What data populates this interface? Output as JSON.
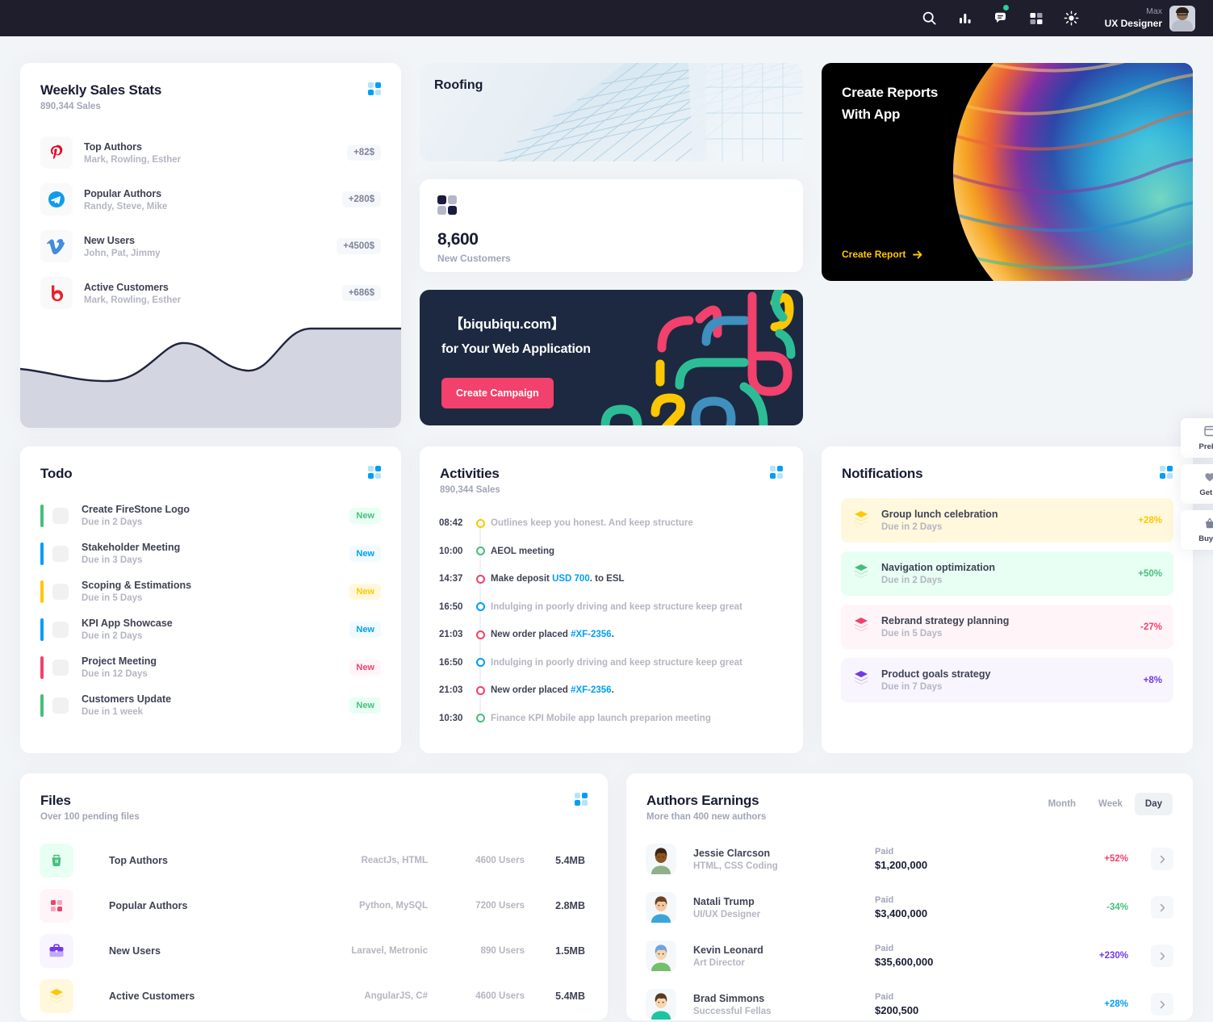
{
  "header": {
    "icons": [
      "search-icon",
      "chart-bar-icon",
      "chat-icon",
      "apps-grid-icon",
      "brightness-icon"
    ],
    "user": {
      "name": "Max",
      "role": "UX Designer"
    }
  },
  "weekly_sales": {
    "title": "Weekly Sales Stats",
    "subtitle": "890,344 Sales",
    "items": [
      {
        "icon": "pinterest-icon",
        "name": "Top Authors",
        "people": "Mark, Rowling, Esther",
        "amount": "+82$"
      },
      {
        "icon": "telegram-icon",
        "name": "Popular Authors",
        "people": "Randy, Steve, Mike",
        "amount": "+280$"
      },
      {
        "icon": "vimeo-icon",
        "name": "New Users",
        "people": "John, Pat, Jimmy",
        "amount": "+4500$"
      },
      {
        "icon": "bloglovin-icon",
        "name": "Active Customers",
        "people": "Mark, Rowling, Esther",
        "amount": "+686$"
      }
    ]
  },
  "roofing": {
    "title": "Roofing"
  },
  "new_customers": {
    "value": "8,600",
    "label": "New Customers"
  },
  "reports": {
    "line1": "Create Reports",
    "line2": "With App",
    "cta": "Create Report",
    "cta_color": "#ffc700"
  },
  "banner": {
    "line1": "【biqubiqu.com】",
    "line2": "for Your Web Application",
    "button": "Create Campaign",
    "button_color": "#f1416c"
  },
  "todo": {
    "title": "Todo",
    "items": [
      {
        "name": "Create FireStone Logo",
        "due": "Due in 2 Days",
        "badge": "New",
        "bar_color": "#47be7d",
        "badge_bg": "#e8fff3",
        "badge_fg": "#47be7d"
      },
      {
        "name": "Stakeholder Meeting",
        "due": "Due in 3 Days",
        "badge": "New",
        "bar_color": "#009ef7",
        "badge_bg": "#f1faff",
        "badge_fg": "#009ef7"
      },
      {
        "name": "Scoping & Estimations",
        "due": "Due in 5 Days",
        "badge": "New",
        "bar_color": "#ffc700",
        "badge_bg": "#fff8dd",
        "badge_fg": "#ffc700"
      },
      {
        "name": "KPI App Showcase",
        "due": "Due in 2 Days",
        "badge": "New",
        "bar_color": "#009ef7",
        "badge_bg": "#f1faff",
        "badge_fg": "#009ef7"
      },
      {
        "name": "Project Meeting",
        "due": "Due in 12 Days",
        "badge": "New",
        "bar_color": "#f1416c",
        "badge_bg": "#fff5f8",
        "badge_fg": "#f1416c"
      },
      {
        "name": "Customers Update",
        "due": "Due in 1 week",
        "badge": "New",
        "bar_color": "#47be7d",
        "badge_bg": "#e8fff3",
        "badge_fg": "#47be7d"
      }
    ]
  },
  "activities": {
    "title": "Activities",
    "subtitle": "890,344 Sales",
    "items": [
      {
        "time": "08:42",
        "dot": "#ffc700",
        "text": "Outlines keep you honest. And keep structure",
        "style": "muted"
      },
      {
        "time": "10:00",
        "dot": "#47be7d",
        "text": "AEOL meeting",
        "style": "dark"
      },
      {
        "time": "14:37",
        "dot": "#f1416c",
        "text": "Make deposit ",
        "link": "USD 700",
        "tail": ". to ESL",
        "style": "dark"
      },
      {
        "time": "16:50",
        "dot": "#009ef7",
        "text": "Indulging in poorly driving and keep structure keep great",
        "style": "muted"
      },
      {
        "time": "21:03",
        "dot": "#f1416c",
        "text": "New order placed ",
        "link": "#XF-2356",
        "tail": ".",
        "style": "dark"
      },
      {
        "time": "16:50",
        "dot": "#009ef7",
        "text": "Indulging in poorly driving and keep structure keep great",
        "style": "muted"
      },
      {
        "time": "21:03",
        "dot": "#f1416c",
        "text": "New order placed ",
        "link": "#XF-2356",
        "tail": ".",
        "style": "dark"
      },
      {
        "time": "10:30",
        "dot": "#47be7d",
        "text": "Finance KPI Mobile app launch preparion meeting",
        "style": "muted"
      }
    ]
  },
  "notifications": {
    "title": "Notifications",
    "items": [
      {
        "name": "Group lunch celebration",
        "due": "Due in 2 Days",
        "pct": "+28%",
        "bg": "#fff8dd",
        "color": "#ffc700"
      },
      {
        "name": "Navigation optimization",
        "due": "Due in 2 Days",
        "pct": "+50%",
        "bg": "#e8fff3",
        "color": "#47be7d"
      },
      {
        "name": "Rebrand strategy planning",
        "due": "Due in 5 Days",
        "pct": "-27%",
        "bg": "#fff5f8",
        "color": "#f1416c"
      },
      {
        "name": "Product goals strategy",
        "due": "Due in 7 Days",
        "pct": "+8%",
        "bg": "#f8f5ff",
        "color": "#7239ea"
      }
    ]
  },
  "files": {
    "title": "Files",
    "subtitle": "Over 100 pending files",
    "rows": [
      {
        "icon": "trash-icon",
        "icon_bg": "#e8fff3",
        "icon_fg": "#47be7d",
        "name": "Top Authors",
        "tech": "ReactJs, HTML",
        "users": "4600 Users",
        "size": "5.4MB"
      },
      {
        "icon": "grid-icon",
        "icon_bg": "#fff5f8",
        "icon_fg": "#f1416c",
        "name": "Popular Authors",
        "tech": "Python, MySQL",
        "users": "7200 Users",
        "size": "2.8MB"
      },
      {
        "icon": "briefcase-icon",
        "icon_bg": "#f8f5ff",
        "icon_fg": "#7239ea",
        "name": "New Users",
        "tech": "Laravel, Metronic",
        "users": "890 Users",
        "size": "1.5MB"
      },
      {
        "icon": "layers-icon",
        "icon_bg": "#fff8dd",
        "icon_fg": "#ffc700",
        "name": "Active Customers",
        "tech": "AngularJS, C#",
        "users": "4600 Users",
        "size": "5.4MB"
      }
    ]
  },
  "earnings": {
    "title": "Authors Earnings",
    "subtitle": "More than 400 new authors",
    "tabs": [
      {
        "label": "Month",
        "active": false
      },
      {
        "label": "Week",
        "active": false
      },
      {
        "label": "Day",
        "active": true
      }
    ],
    "paid_label": "Paid",
    "rows": [
      {
        "name": "Jessie Clarcson",
        "role": "HTML, CSS Coding",
        "paid": "$1,200,000",
        "pct": "+52%",
        "pct_color": "#f1416c",
        "skin": "#8d5524",
        "hair": "#3b2414",
        "shirt": "#8fb08a"
      },
      {
        "name": "Natali Trump",
        "role": "UI/UX Designer",
        "paid": "$3,400,000",
        "pct": "-34%",
        "pct_color": "#47be7d",
        "skin": "#f2c9a0",
        "hair": "#6b4226",
        "shirt": "#3ba5d8"
      },
      {
        "name": "Kevin Leonard",
        "role": "Art Director",
        "paid": "$35,600,000",
        "pct": "+230%",
        "pct_color": "#7239ea",
        "skin": "#f5d6b0",
        "hair": "#6fa3e0",
        "shirt": "#72c06a"
      },
      {
        "name": "Brad Simmons",
        "role": "Successful Fellas",
        "paid": "$200,500",
        "pct": "+28%",
        "pct_color": "#009ef7",
        "skin": "#f5d6b0",
        "hair": "#5a3a20",
        "shirt": "#1bc5a0"
      }
    ]
  },
  "float_panel": [
    {
      "icon": "layout-icon",
      "label": "Prebu"
    },
    {
      "icon": "heart-icon",
      "label": "Get H"
    },
    {
      "icon": "basket-icon",
      "label": "Buy N"
    }
  ]
}
